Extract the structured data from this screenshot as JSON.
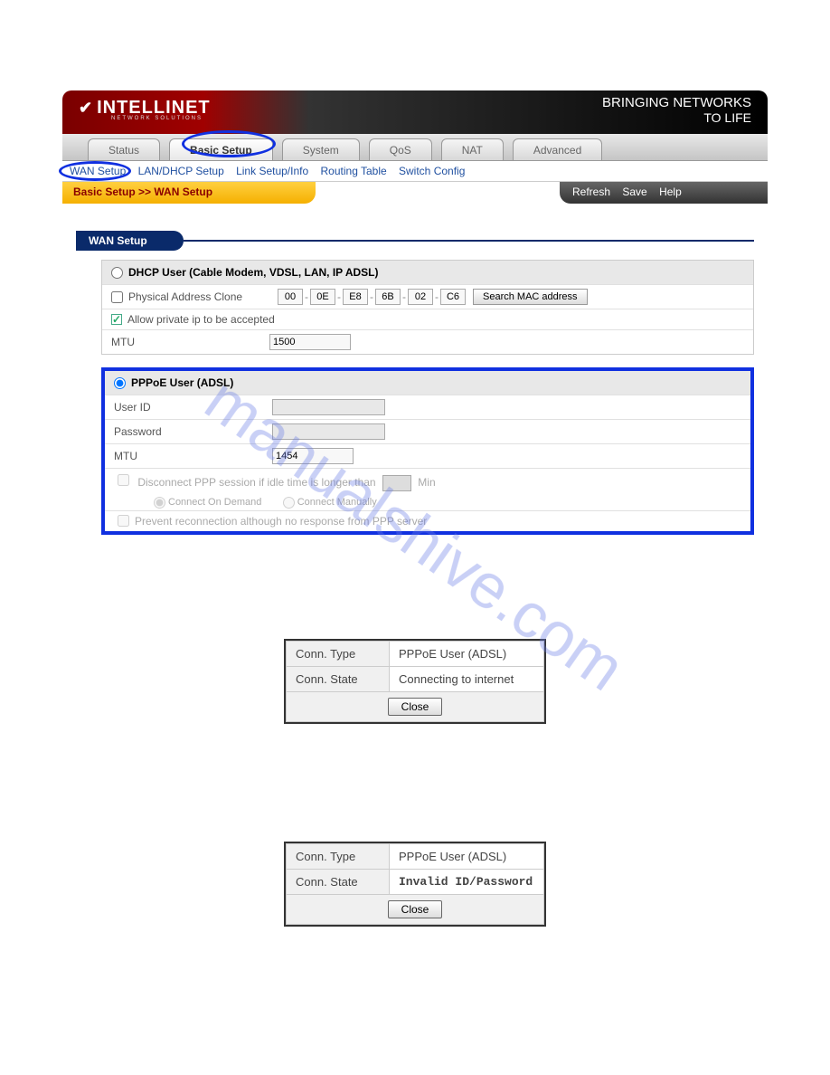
{
  "header": {
    "brand": "INTELLINET",
    "brand_sub": "NETWORK SOLUTIONS",
    "slogan1": "BRINGING NETWORKS",
    "slogan2": "TO LIFE"
  },
  "tabs": [
    {
      "label": "Status"
    },
    {
      "label": "Basic Setup"
    },
    {
      "label": "System"
    },
    {
      "label": "QoS"
    },
    {
      "label": "NAT"
    },
    {
      "label": "Advanced"
    }
  ],
  "subnav": [
    "WAN Setup",
    "LAN/DHCP Setup",
    "Link Setup/Info",
    "Routing Table",
    "Switch Config"
  ],
  "breadcrumb": "Basic Setup >> WAN Setup",
  "actions": {
    "refresh": "Refresh",
    "save": "Save",
    "help": "Help"
  },
  "section_title": "WAN Setup",
  "dhcp": {
    "title": "DHCP User (Cable Modem, VDSL, LAN, IP ADSL)",
    "phys_clone_label": "Physical Address Clone",
    "mac": [
      "00",
      "0E",
      "E8",
      "6B",
      "02",
      "C6"
    ],
    "search_mac_btn": "Search MAC address",
    "allow_private": "Allow private ip to be accepted",
    "mtu_label": "MTU",
    "mtu_value": "1500"
  },
  "pppoe": {
    "title": "PPPoE User (ADSL)",
    "userid_label": "User ID",
    "password_label": "Password",
    "mtu_label": "MTU",
    "mtu_value": "1454",
    "disconnect_label_1": "Disconnect PPP session if idle time is longer than",
    "idle_value": "",
    "min_label": "Min",
    "connect_on_demand": "Connect On Demand",
    "connect_manually": "Connect Manually",
    "prevent_label": "Prevent reconnection although no response from PPP server"
  },
  "dialog1": {
    "conn_type_label": "Conn. Type",
    "conn_type_value": "PPPoE User (ADSL)",
    "conn_state_label": "Conn. State",
    "conn_state_value": "Connecting to internet",
    "close": "Close"
  },
  "dialog2": {
    "conn_type_label": "Conn. Type",
    "conn_type_value": "PPPoE User (ADSL)",
    "conn_state_label": "Conn. State",
    "conn_state_value": "Invalid ID/Password",
    "close": "Close"
  },
  "watermark": "manualshive.com"
}
